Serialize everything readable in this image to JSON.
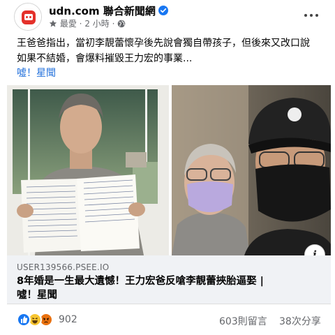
{
  "post": {
    "page_name": "udn.com 聯合新聞網",
    "meta": {
      "relevance": "最愛",
      "separator": "·",
      "time": "2 小時",
      "audience_icon": "globe-icon"
    },
    "body_lines": [
      "王爸爸指出，當初李靚蕾懷孕後先說會獨自帶孩子，但後來又改口說",
      "如果不結婚，會爆料摧毀王力宏的事業..."
    ],
    "tag": "噓！星聞"
  },
  "link_preview": {
    "domain": "USER139566.PSEE.IO",
    "title_lines": [
      "8年婚是一生最大遺憾！王力宏爸反嗆李靚蕾挾胎逼娶 |",
      "噓！星聞"
    ]
  },
  "engagement": {
    "reaction_icons": [
      "like-icon",
      "haha-icon",
      "angry-icon"
    ],
    "reaction_count": "902",
    "comments": "603則留言",
    "shares": "38次分享"
  },
  "colors": {
    "link_blue": "#216fdb",
    "verified_blue": "#1877f2",
    "link_box_bg": "#f0f2f5",
    "meta_gray": "#65676b"
  }
}
